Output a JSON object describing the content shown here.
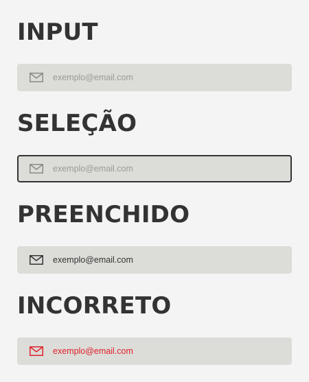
{
  "sections": [
    {
      "heading": "INPUT",
      "field": {
        "text": "exemplo@email.com",
        "icon": "mail-icon",
        "text_color": "#9a9a96",
        "icon_color": "#8a8a86"
      }
    },
    {
      "heading": "SELEÇÃO",
      "field": {
        "text": "exemplo@email.com",
        "icon": "mail-icon",
        "text_color": "#9a9a96",
        "icon_color": "#8a8a86",
        "border_color": "#333333"
      }
    },
    {
      "heading": "PREENCHIDO",
      "field": {
        "text": "exemplo@email.com",
        "icon": "mail-icon",
        "text_color": "#333333",
        "icon_color": "#333333"
      }
    },
    {
      "heading": "INCORRETO",
      "field": {
        "text": "exemplo@email.com",
        "icon": "mail-icon",
        "text_color": "#e0202a",
        "icon_color": "#e0202a"
      }
    }
  ],
  "colors": {
    "background": "#f4f4f4",
    "field_background": "#dcdcd8",
    "heading": "#333333",
    "error": "#e0202a"
  }
}
